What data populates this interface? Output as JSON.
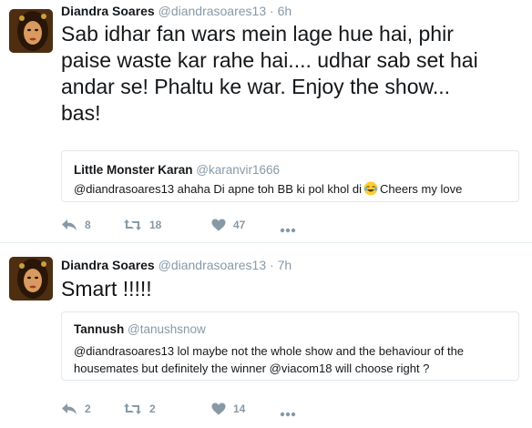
{
  "tweets": [
    {
      "author_name": "Diandra Soares",
      "author_handle": "@diandrasoares13",
      "timestamp": "· 6h",
      "text_lines": [
        "Sab idhar fan wars mein lage hue hai, phir",
        "paise waste kar rahe hai.... udhar sab set hai",
        "andar se! Phaltu ke war. Enjoy the show...",
        "bas!"
      ],
      "quote": {
        "name": "Little Monster Karan",
        "handle": "@karanvir1666",
        "text_before_emoji": "@diandrasoares13 ahaha Di apne toh BB ki pol khol di",
        "emoji": "laughing-with-tears-emoji",
        "text_after_emoji": "Cheers my love"
      },
      "replies": "8",
      "retweets": "18",
      "likes": "47"
    },
    {
      "author_name": "Diandra Soares",
      "author_handle": "@diandrasoares13",
      "timestamp": "· 7h",
      "text_lines": [
        "Smart !!!!!"
      ],
      "quote": {
        "name": "Tannush",
        "handle": "@tanushsnow",
        "text_lines": [
          "@diandrasoares13 lol maybe not the whole show and the behaviour of the",
          "housemates but definitely the winner @viacom18 will choose right ?"
        ]
      },
      "replies": "2",
      "retweets": "2",
      "likes": "14"
    }
  ],
  "colors": {
    "text": "#14171a",
    "secondary": "#8899a6",
    "border": "#e1e8ed"
  },
  "icons": [
    "reply-icon",
    "retweet-icon",
    "like-icon",
    "more-icon"
  ]
}
